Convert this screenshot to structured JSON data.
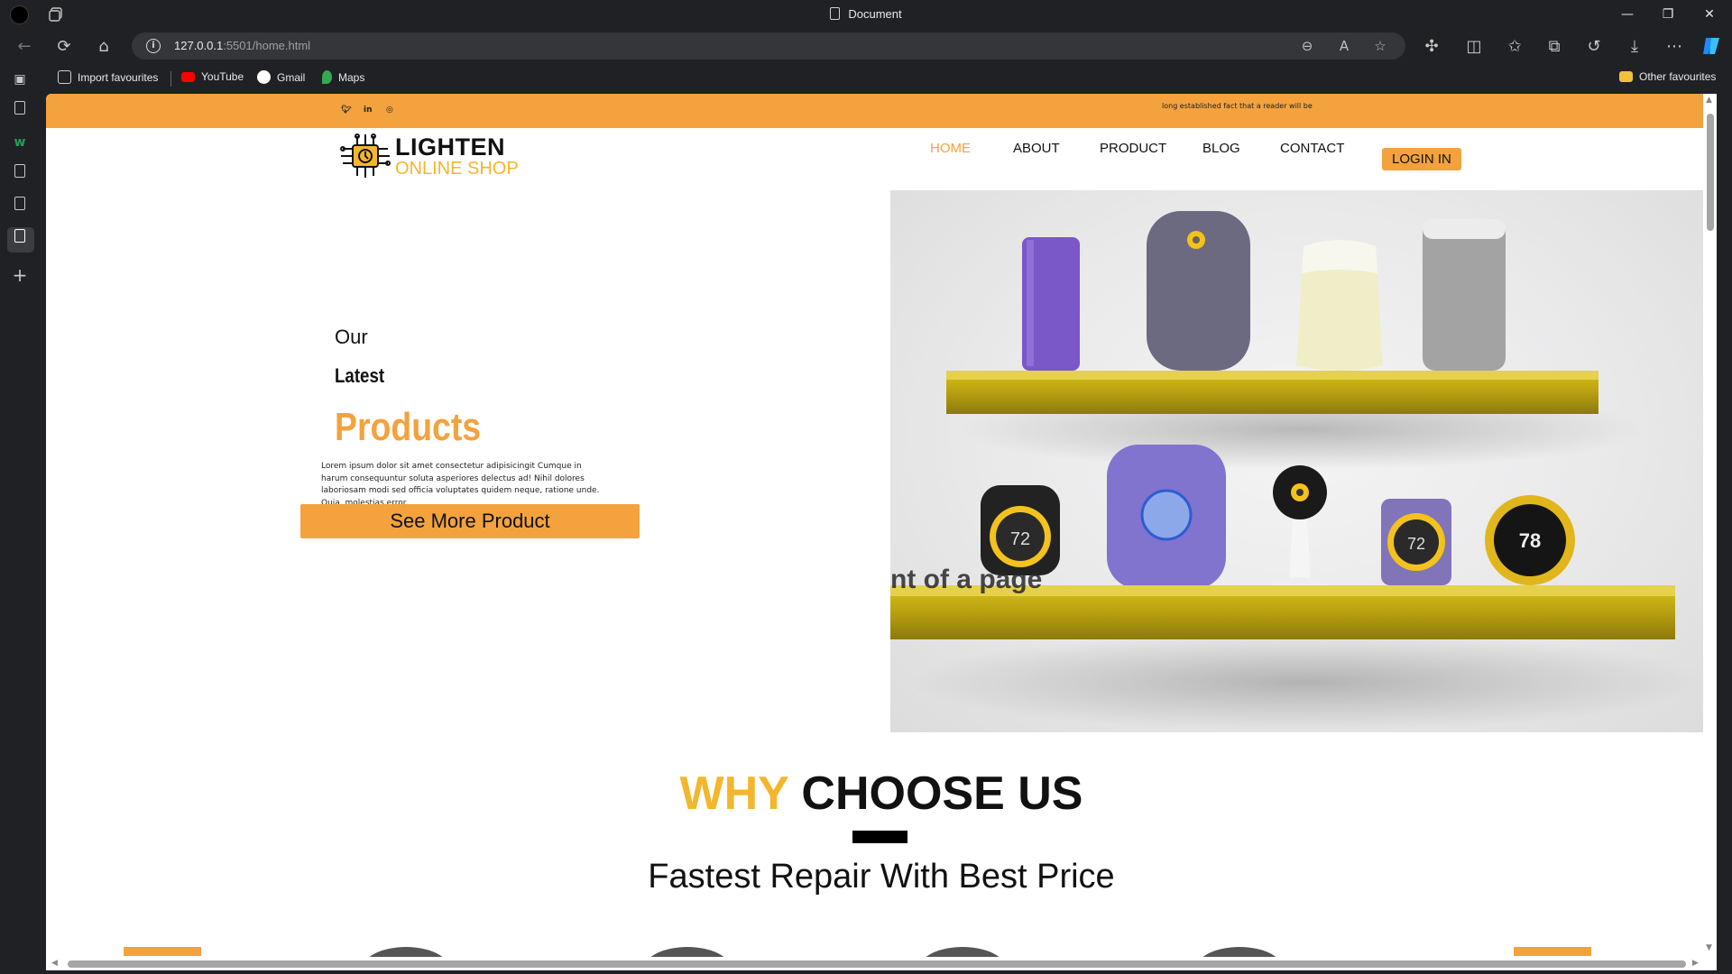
{
  "browser": {
    "window_title": "Document",
    "url_host": "127.0.0.1",
    "url_rest": ":5501/home.html",
    "bookmarks": [
      "Import favourites",
      "YouTube",
      "Gmail",
      "Maps"
    ],
    "other_favourites": "Other favourites"
  },
  "site": {
    "top_strip_text": "long established fact that a reader will be",
    "social": [
      "twitter-icon",
      "linkedin-icon",
      "instagram-icon"
    ],
    "logo": {
      "line1": "LIGHTEN",
      "line2": "ONLINE SHOP"
    },
    "nav": [
      "HOME",
      "ABOUT",
      "PRODUCT",
      "BLOG",
      "CONTACT"
    ],
    "nav_active": "HOME",
    "login_label": "LOGIN IN",
    "hero": {
      "line1": "Our",
      "line2": "Latest",
      "line3": "Products",
      "body": "Lorem ipsum dolor sit amet consectetur adipisicingit Cumque in harum consequuntur soluta asperiores delectus ad! Nihil dolores laboriosam modi sed officia voluptates quidem neque, ratione unde. Quia, molestias error.",
      "cta": "See More Product",
      "image_overlay_text": "nt of a page",
      "device_readouts": [
        "72",
        "72",
        "78"
      ]
    },
    "why": {
      "word1": "WHY",
      "word2": "CHOOSE US",
      "subtitle": "Fastest Repair With Best Price"
    }
  },
  "colors": {
    "accent": "#f3a23d",
    "logo_yellow": "#f3b62d",
    "chrome_bg": "#202124"
  }
}
